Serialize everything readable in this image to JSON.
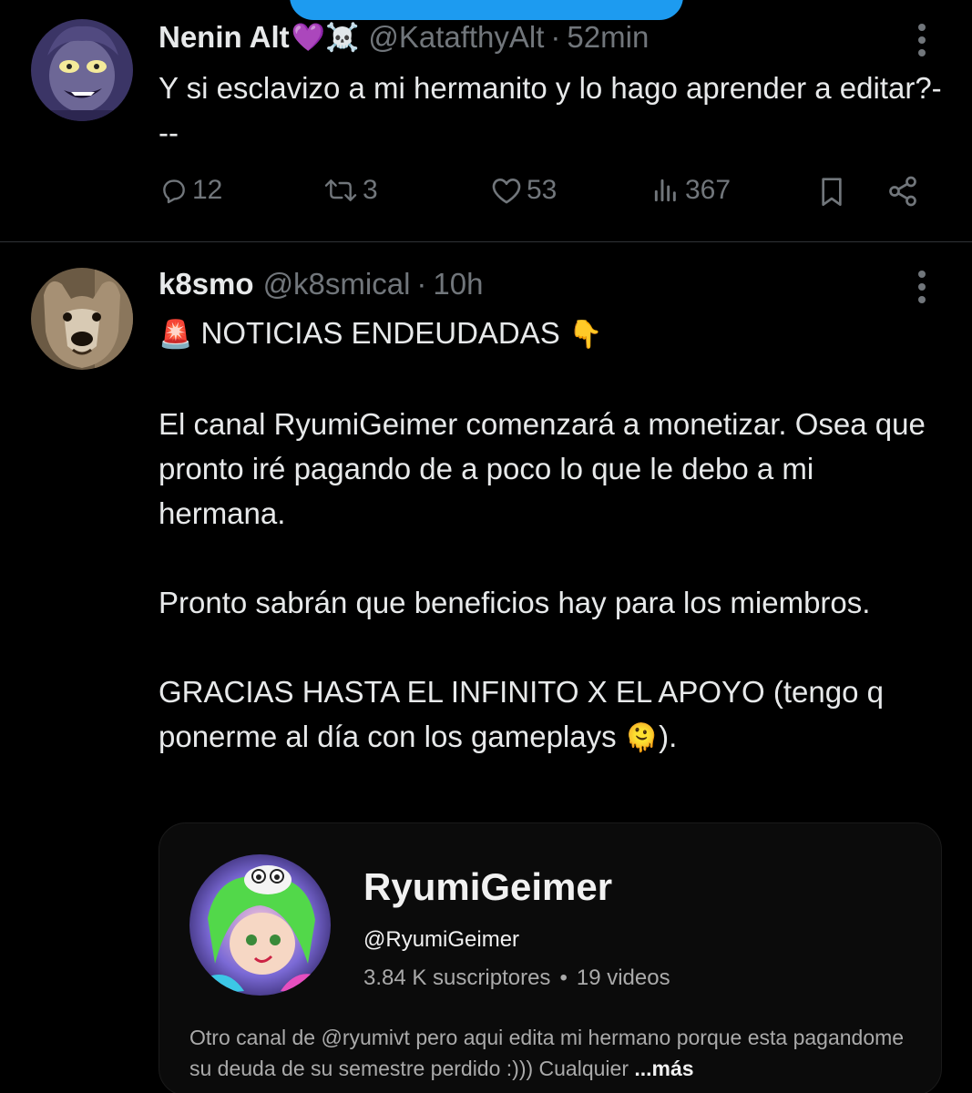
{
  "tweets": [
    {
      "display_name": "Nenin Alt",
      "name_emojis": "💜☠️",
      "handle": "@KatafthyAlt",
      "dot": "·",
      "time": "52min",
      "text": "Y si esclavizo a mi hermanito y lo hago aprender a editar?---",
      "actions": {
        "replies": "12",
        "retweets": "3",
        "likes": "53",
        "views": "367"
      }
    },
    {
      "display_name": "k8smo",
      "handle": "@k8smical",
      "dot": "·",
      "time": "10h",
      "lines": {
        "headline_emoji_start": "🚨",
        "headline": "NOTICIAS ENDEUDADAS",
        "headline_emoji_end": "👇",
        "p1": "El canal RyumiGeimer comenzará a monetizar. Osea que pronto iré pagando de a poco lo que le debo a mi hermana.",
        "p2": "Pronto sabrán que beneficios hay para los miembros.",
        "p3": "GRACIAS HASTA EL INFINITO X EL APOYO (tengo q ponerme al día con los gameplays",
        "p3_emoji": "🫠",
        "p3_end": ")."
      },
      "card": {
        "channel_name": "RyumiGeimer",
        "channel_handle": "@RyumiGeimer",
        "subscribers": "3.84 K suscriptores",
        "separator": "•",
        "videos": "19 videos",
        "description": "Otro canal de @ryumivt pero aqui edita mi hermano porque esta pagandome su deuda de su semestre perdido :)))  Cualquier",
        "more_label": "...más"
      }
    }
  ],
  "icons": {
    "reply": "reply-icon",
    "retweet": "retweet-icon",
    "like": "heart-icon",
    "views": "views-icon",
    "bookmark": "bookmark-icon",
    "share": "share-icon",
    "more": "more-vertical-icon"
  },
  "colors": {
    "background": "#000000",
    "text": "#e7e9ea",
    "muted": "#71767b",
    "accent": "#1d9bf0",
    "divider": "#2f3336"
  }
}
